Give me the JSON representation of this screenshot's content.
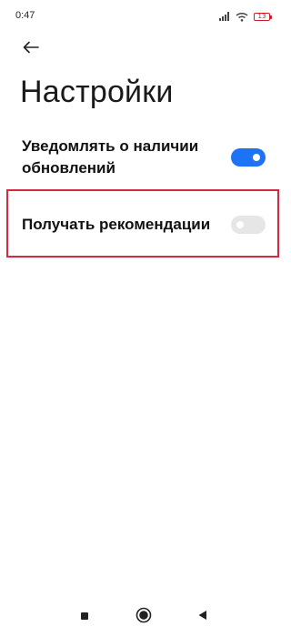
{
  "status_bar": {
    "time": "0:47",
    "battery_level": "13",
    "battery_color": "#d11a2a",
    "icons": [
      "signal-icon",
      "wifi-icon",
      "battery-icon"
    ]
  },
  "header": {
    "back_icon": "arrow-left-icon",
    "title": "Настройки"
  },
  "settings": [
    {
      "label": "Уведомлять о наличии обновлений",
      "enabled": true
    },
    {
      "label": "Получать рекомендации",
      "enabled": false
    }
  ],
  "colors": {
    "toggle_on": "#1d73f5",
    "toggle_off": "#e6e6e6",
    "highlight_border": "#d8283e"
  },
  "nav_bar": {
    "icons": [
      "recents-square-icon",
      "home-circle-icon",
      "back-triangle-icon"
    ]
  }
}
